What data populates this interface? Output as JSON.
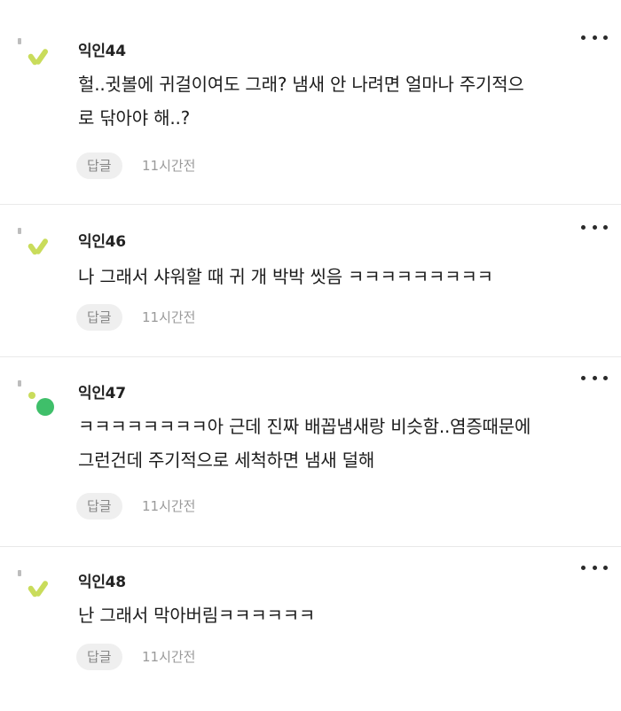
{
  "colors": {
    "leaf_light": "#c9dc5b",
    "leaf_dark": "#8fbf3a",
    "accent_green": "#3fbf6a",
    "dot_gray": "#bdbdbd"
  },
  "comments": [
    {
      "nickname": "익인44",
      "lines": [
        "헐..귓볼에 귀걸이여도 그래? 냄새 안 나려면 얼마나 주기적으",
        "로 닦아야 해..?"
      ],
      "reply_label": "답글",
      "time": "11시간전",
      "avatar_icon": "leaf-sprout-icon"
    },
    {
      "nickname": "익인46",
      "lines": [
        "나 그래서 샤워할 때 귀 개 박박 씻음 ㅋㅋㅋㅋㅋㅋㅋㅋㅋ"
      ],
      "reply_label": "답글",
      "time": "11시간전",
      "avatar_icon": "leaf-sprout-icon"
    },
    {
      "nickname": "익인47",
      "lines": [
        "ㅋㅋㅋㅋㅋㅋㅋㅋ아 근데 진짜 배꼽냄새랑 비슷함..염증때문에",
        "그런건데 주기적으로 세척하면 냄새 덜해"
      ],
      "reply_label": "답글",
      "time": "11시간전",
      "avatar_icon": "green-dots-icon"
    },
    {
      "nickname": "익인48",
      "lines": [
        "난 그래서 막아버림ㅋㅋㅋㅋㅋㅋ"
      ],
      "reply_label": "답글",
      "time": "11시간전",
      "avatar_icon": "leaf-sprout-icon"
    }
  ]
}
